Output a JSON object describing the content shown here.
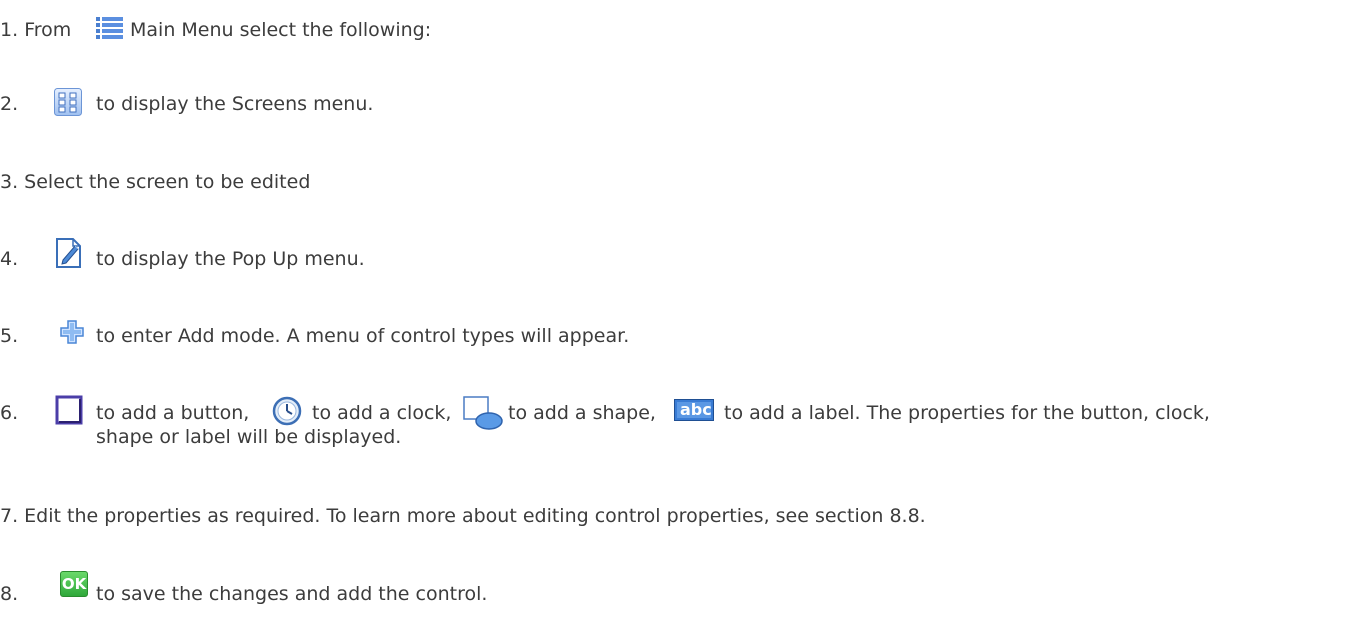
{
  "steps": [
    {
      "num": "1.",
      "pre": "From",
      "post": "Main Menu select the following:",
      "icon": "main-menu-icon"
    },
    {
      "num": "2.",
      "post": "to display the Screens menu.",
      "icon": "screens-icon"
    },
    {
      "text": "3. Select the screen to be edited"
    },
    {
      "num": "4.",
      "post": "to display the Pop Up menu.",
      "icon": "edit-icon"
    },
    {
      "num": "5.",
      "post": "to enter Add mode. A menu of control types will appear.",
      "icon": "add-icon"
    },
    {
      "num": "6.",
      "seg_button": "to add a button,",
      "seg_clock": "to add a clock,",
      "seg_shape": "to add a shape,",
      "seg_label": "to add a label. The properties for the button, clock,",
      "line2": "shape or label will be displayed.",
      "icons": [
        "button-icon",
        "clock-icon",
        "shape-icon",
        "label-icon"
      ]
    },
    {
      "text": "7. Edit the properties as required. To learn more about editing control properties, see section 8.8."
    },
    {
      "num": "8.",
      "post": "to save the changes and add the control.",
      "icon": "ok-icon",
      "icon_text": "OK"
    }
  ],
  "label_icon_text": "abc",
  "colors": {
    "text": "#3c3c3c",
    "icon_blue": "#2f6fc8",
    "ok_green": "#3cb43c"
  }
}
